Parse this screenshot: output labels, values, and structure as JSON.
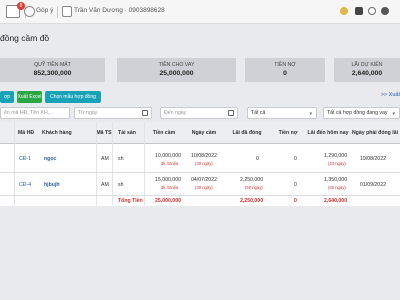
{
  "topbar": {
    "messages_badge": "8",
    "feedback_label": "Góp ý",
    "user_label": "Trần Văn Dương · 0903898628"
  },
  "page": {
    "title": "đồng cầm đồ"
  },
  "stats": [
    {
      "label": "QUỸ TIỀN MẶT",
      "value": "852,300,000"
    },
    {
      "label": "TIỀN CHO VAY",
      "value": "25,000,000"
    },
    {
      "label": "TIỀN NỢ",
      "value": "0"
    },
    {
      "label": "LÃI DỰ KIẾN",
      "value": "2,640,000"
    }
  ],
  "actions": {
    "add_label": "ợp mới",
    "excel_label": "Xuất Excel",
    "template_label": "Chọn mẫu hợp đồng",
    "more_label": ">> Xuất"
  },
  "filters": {
    "search_placeholder": "ên mã HĐ, Tên KH,...",
    "from_date_placeholder": "Từ ngày",
    "to_date_placeholder": "Đến ngày",
    "status_value": "Tất cả",
    "contract_type_value": "Tất cả hợp đồng đang vay"
  },
  "table": {
    "headers": [
      "Mã HĐ",
      "Khách hàng",
      "Mã TS",
      "Tài sản",
      "Tiền cầm",
      "Ngày cầm",
      "Lãi đã đóng",
      "Tiền nợ",
      "Lãi đến hôm nay",
      "Ngày phải đóng lãi"
    ],
    "rows": [
      {
        "code": "CĐ-1",
        "customer": "ngọc",
        "asset_code": "AM",
        "asset": "sh",
        "amount": "10,000,000",
        "rate": "3k /1triệu",
        "date": "10/08/2022",
        "days": "(30 ngày)",
        "interest_paid": "0",
        "debt": "0",
        "interest_today": "1,290,000",
        "interest_days": "(43 ngày)",
        "due_date": "19/08/2022"
      },
      {
        "code": "CĐ-4",
        "customer": "hjbujh",
        "asset_code": "AM",
        "asset": "sh",
        "amount": "15,000,000",
        "rate": "3k /1triệu",
        "date": "04/07/2022",
        "days": "(30 ngày)",
        "interest_paid": "2,250,000",
        "interest_paid_days": "(50 ngày)",
        "debt": "0",
        "interest_today": "1,350,000",
        "interest_days": "(30 ngày)",
        "due_date": "01/09/2022"
      }
    ],
    "totals": {
      "label": "Tổng Tiền",
      "amount": "25,000,000",
      "interest_paid": "2,250,000",
      "debt": "0",
      "interest_today": "2,640,000"
    }
  }
}
